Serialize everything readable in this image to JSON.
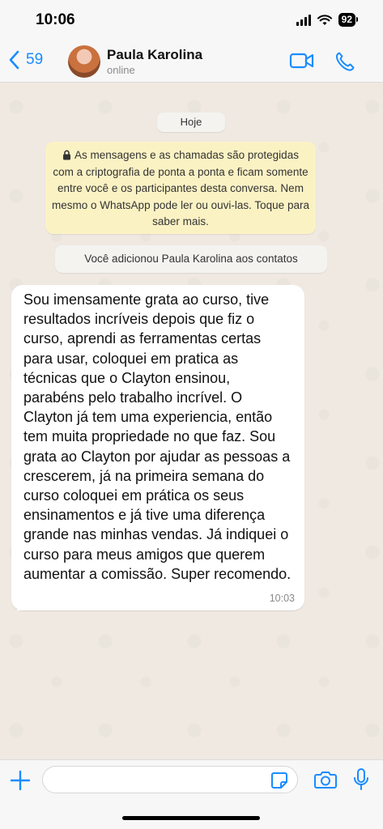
{
  "status_bar": {
    "time": "10:06",
    "battery": "92"
  },
  "header": {
    "back_count": "59",
    "contact_name": "Paula Karolina",
    "contact_status": "online"
  },
  "chat": {
    "date_chip": "Hoje",
    "encryption_notice": "As mensagens e as chamadas são protegidas com a criptografia de ponta a ponta e ficam somente entre você e os participantes desta conversa. Nem mesmo o WhatsApp pode ler ou ouvi-las. Toque para saber mais.",
    "system_message": "Você adicionou Paula Karolina aos contatos",
    "messages": [
      {
        "text": "Sou imensamente grata ao curso, tive resultados incríveis depois que fiz o curso, aprendi as ferramentas certas para usar, coloquei em pratica as técnicas que o Clayton ensinou, parabéns pelo trabalho incrível. O Clayton já tem uma experiencia, então tem muita propriedade no que faz. Sou grata ao Clayton por ajudar as pessoas a crescerem, já na primeira semana do curso coloquei em prática os seus ensinamentos e já tive uma diferença grande nas minhas vendas. Já indiquei o curso para meus amigos que querem aumentar a comissão. Super recomendo.",
        "time": "10:03"
      }
    ]
  },
  "input": {
    "value": "",
    "placeholder": ""
  },
  "colors": {
    "accent": "#1a8cff",
    "chat_background": "#efe9e1",
    "encryption_background": "#fbf2c4",
    "bubble_incoming": "#ffffff"
  },
  "icons": [
    "chevron-left-icon",
    "video-icon",
    "phone-icon",
    "lock-icon",
    "plus-icon",
    "sticker-icon",
    "camera-icon",
    "mic-icon"
  ]
}
